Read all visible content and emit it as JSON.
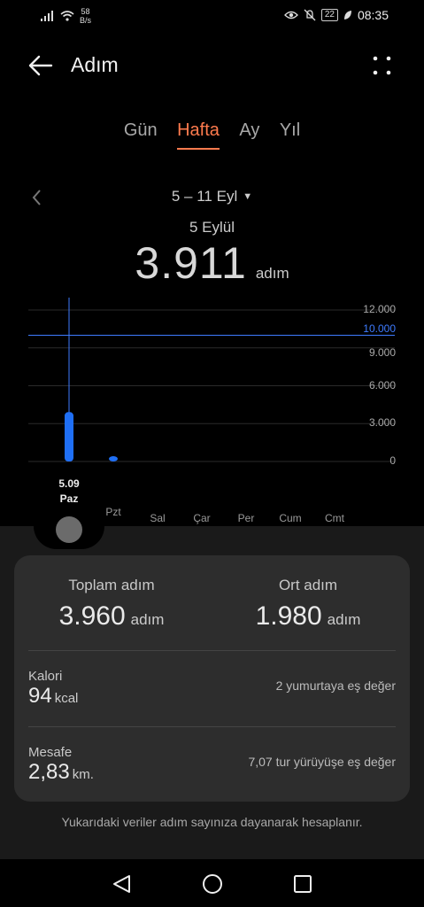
{
  "status_bar": {
    "net_speed_value": "58",
    "net_speed_unit": "B/s",
    "battery": "22",
    "time": "08:35",
    "icons": [
      "signal-icon",
      "wifi-icon",
      "eye-comfort-icon",
      "mute-icon",
      "battery-icon",
      "leaf-icon"
    ]
  },
  "app_bar": {
    "title": "Adım"
  },
  "tabs": [
    {
      "label": "Gün",
      "active": false
    },
    {
      "label": "Hafta",
      "active": true
    },
    {
      "label": "Ay",
      "active": false
    },
    {
      "label": "Yıl",
      "active": false
    }
  ],
  "date_nav": {
    "range": "5 – 11 Eyl",
    "caret": "▼"
  },
  "selection": {
    "date": "5 Eylül",
    "value": "3.911",
    "unit": "adım"
  },
  "chart_data": {
    "type": "bar",
    "categories": [
      "Paz",
      "Pzt",
      "Sal",
      "Çar",
      "Per",
      "Cum",
      "Cmt"
    ],
    "values": [
      3911,
      49,
      0,
      0,
      0,
      0,
      0
    ],
    "y_ticks": [
      "12.000",
      "9.000",
      "6.000",
      "3.000",
      "0"
    ],
    "ylim": [
      0,
      12000
    ],
    "goal_line": {
      "value": 10000,
      "label": "10.000"
    },
    "selected": {
      "index": 0,
      "date_label": "5.09",
      "day_label": "Paz"
    },
    "colors": {
      "bar": "#1f6ff5",
      "goal": "#3e7bff",
      "grid": "#2a2a2a"
    }
  },
  "summary": {
    "total_label": "Toplam adım",
    "total_value": "3.960",
    "total_unit": "adım",
    "avg_label": "Ort adım",
    "avg_value": "1.980",
    "avg_unit": "adım",
    "calorie_label": "Kalori",
    "calorie_value": "94",
    "calorie_unit": "kcal",
    "calorie_equiv": "2 yumurtaya eş değer",
    "distance_label": "Mesafe",
    "distance_value": "2,83",
    "distance_unit": "km.",
    "distance_equiv": "7,07 tur yürüyüşe eş değer"
  },
  "footnote": "Yukarıdaki veriler adım sayınıza dayanarak hesaplanır.",
  "accent": "#ff7b4e"
}
